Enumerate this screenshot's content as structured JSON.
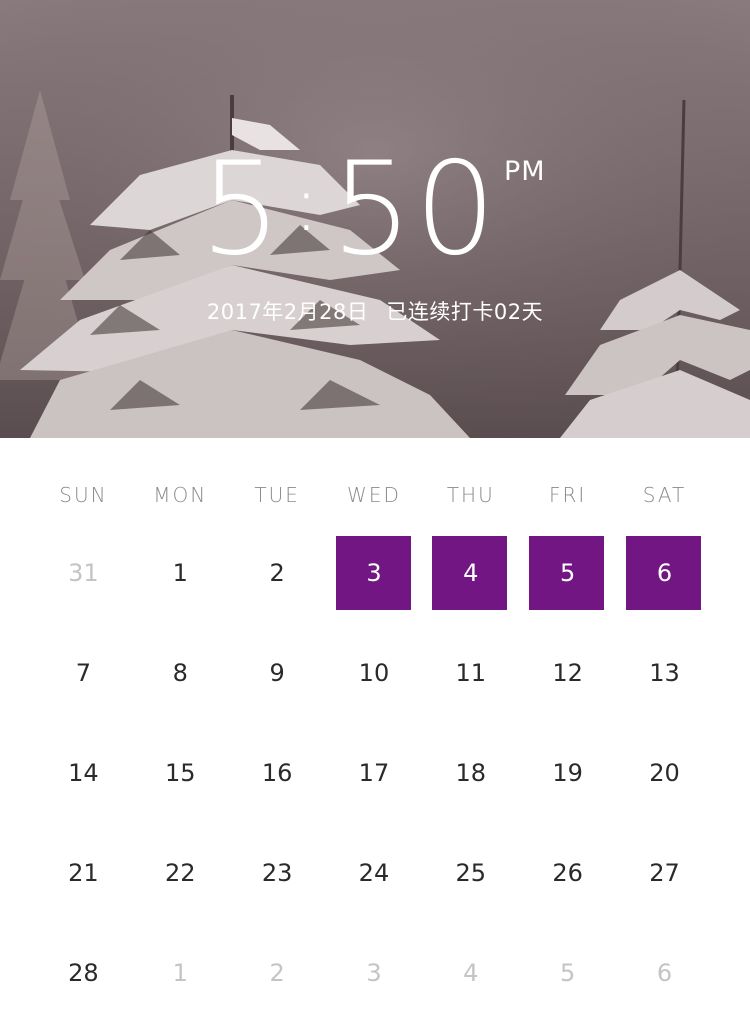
{
  "header": {
    "time_hour": "5",
    "time_colon": ":",
    "time_minutes": "50",
    "ampm": "PM",
    "date": "2017年2月28日",
    "streak": "已连续打卡02天"
  },
  "calendar": {
    "weekdays": [
      "SUN",
      "MON",
      "TUE",
      "WED",
      "THU",
      "FRI",
      "SAT"
    ],
    "weeks": [
      [
        {
          "n": "31",
          "muted": true
        },
        {
          "n": "1"
        },
        {
          "n": "2"
        },
        {
          "n": "3",
          "checked": true
        },
        {
          "n": "4",
          "checked": true
        },
        {
          "n": "5",
          "checked": true
        },
        {
          "n": "6",
          "checked": true
        }
      ],
      [
        {
          "n": "7"
        },
        {
          "n": "8"
        },
        {
          "n": "9"
        },
        {
          "n": "10"
        },
        {
          "n": "11"
        },
        {
          "n": "12"
        },
        {
          "n": "13"
        }
      ],
      [
        {
          "n": "14"
        },
        {
          "n": "15"
        },
        {
          "n": "16"
        },
        {
          "n": "17"
        },
        {
          "n": "18"
        },
        {
          "n": "19"
        },
        {
          "n": "20"
        }
      ],
      [
        {
          "n": "21"
        },
        {
          "n": "22"
        },
        {
          "n": "23"
        },
        {
          "n": "24"
        },
        {
          "n": "25"
        },
        {
          "n": "26"
        },
        {
          "n": "27"
        }
      ],
      [
        {
          "n": "28"
        },
        {
          "n": "1",
          "muted": true
        },
        {
          "n": "2",
          "muted": true
        },
        {
          "n": "3",
          "muted": true
        },
        {
          "n": "4",
          "muted": true
        },
        {
          "n": "5",
          "muted": true
        },
        {
          "n": "6",
          "muted": true
        }
      ]
    ]
  },
  "colors": {
    "accent": "#711683",
    "muted_text": "#c4c4c4",
    "weekday_text": "#8a8a8a"
  }
}
